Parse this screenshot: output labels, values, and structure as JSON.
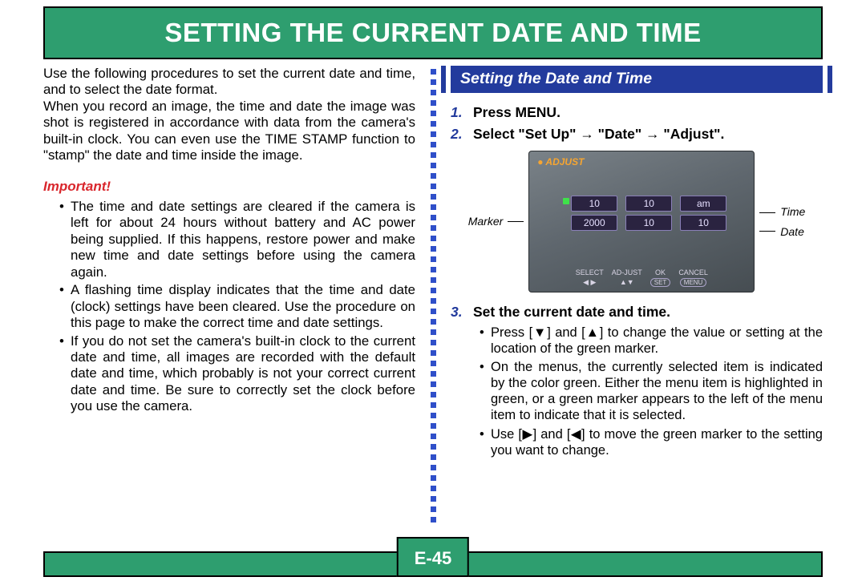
{
  "header": {
    "title": "SETTING THE CURRENT DATE AND TIME"
  },
  "page_number": "E-45",
  "left": {
    "intro1": "Use the following procedures to set the current date and time, and to select the date format.",
    "intro2": "When you record an image, the time and date the image was shot is registered in accordance with data from the camera's built-in clock. You can even use the TIME STAMP function to \"stamp\" the date and time inside the image.",
    "important_label": "Important!",
    "bullets": [
      "The time and date settings are cleared if the camera is left for about 24 hours without battery and AC power being supplied. If this happens, restore power and make new time and date settings before using the camera again.",
      "A flashing time display indicates that the time and date (clock) settings have been cleared. Use the procedure on this page to make the correct time and date settings.",
      "If you do not set the camera's built-in clock to the current date and time, all images are recorded with the default date and time, which probably is not your correct current date and time. Be sure to correctly set the clock before you use the camera."
    ]
  },
  "right": {
    "section_title": "Setting the Date and Time",
    "steps": {
      "s1": "Press MENU.",
      "s2": "Select \"Set Up\" → \"Date\" → \"Adjust\".",
      "s3": "Set the current date and time."
    },
    "lcd": {
      "title": "ADJUST",
      "marker_label": "Marker",
      "time_label": "Time",
      "date_label": "Date",
      "row1": [
        "10",
        "10",
        "am"
      ],
      "row2": [
        "2000",
        "10",
        "10"
      ],
      "footer": [
        "SELECT",
        "AD-JUST",
        "OK",
        "CANCEL"
      ],
      "footer_btn": [
        "",
        "",
        "SET",
        "MENU"
      ]
    },
    "sub": [
      "Press [▼] and [▲] to change the value or setting at the location of the green marker.",
      "On the menus, the currently selected item is indicated by the color green. Either the menu item is highlighted in green, or a green marker appears to the left of the menu item to indicate that it is selected.",
      "Use [▶] and [◀] to move the green marker to the setting you want to change."
    ]
  }
}
